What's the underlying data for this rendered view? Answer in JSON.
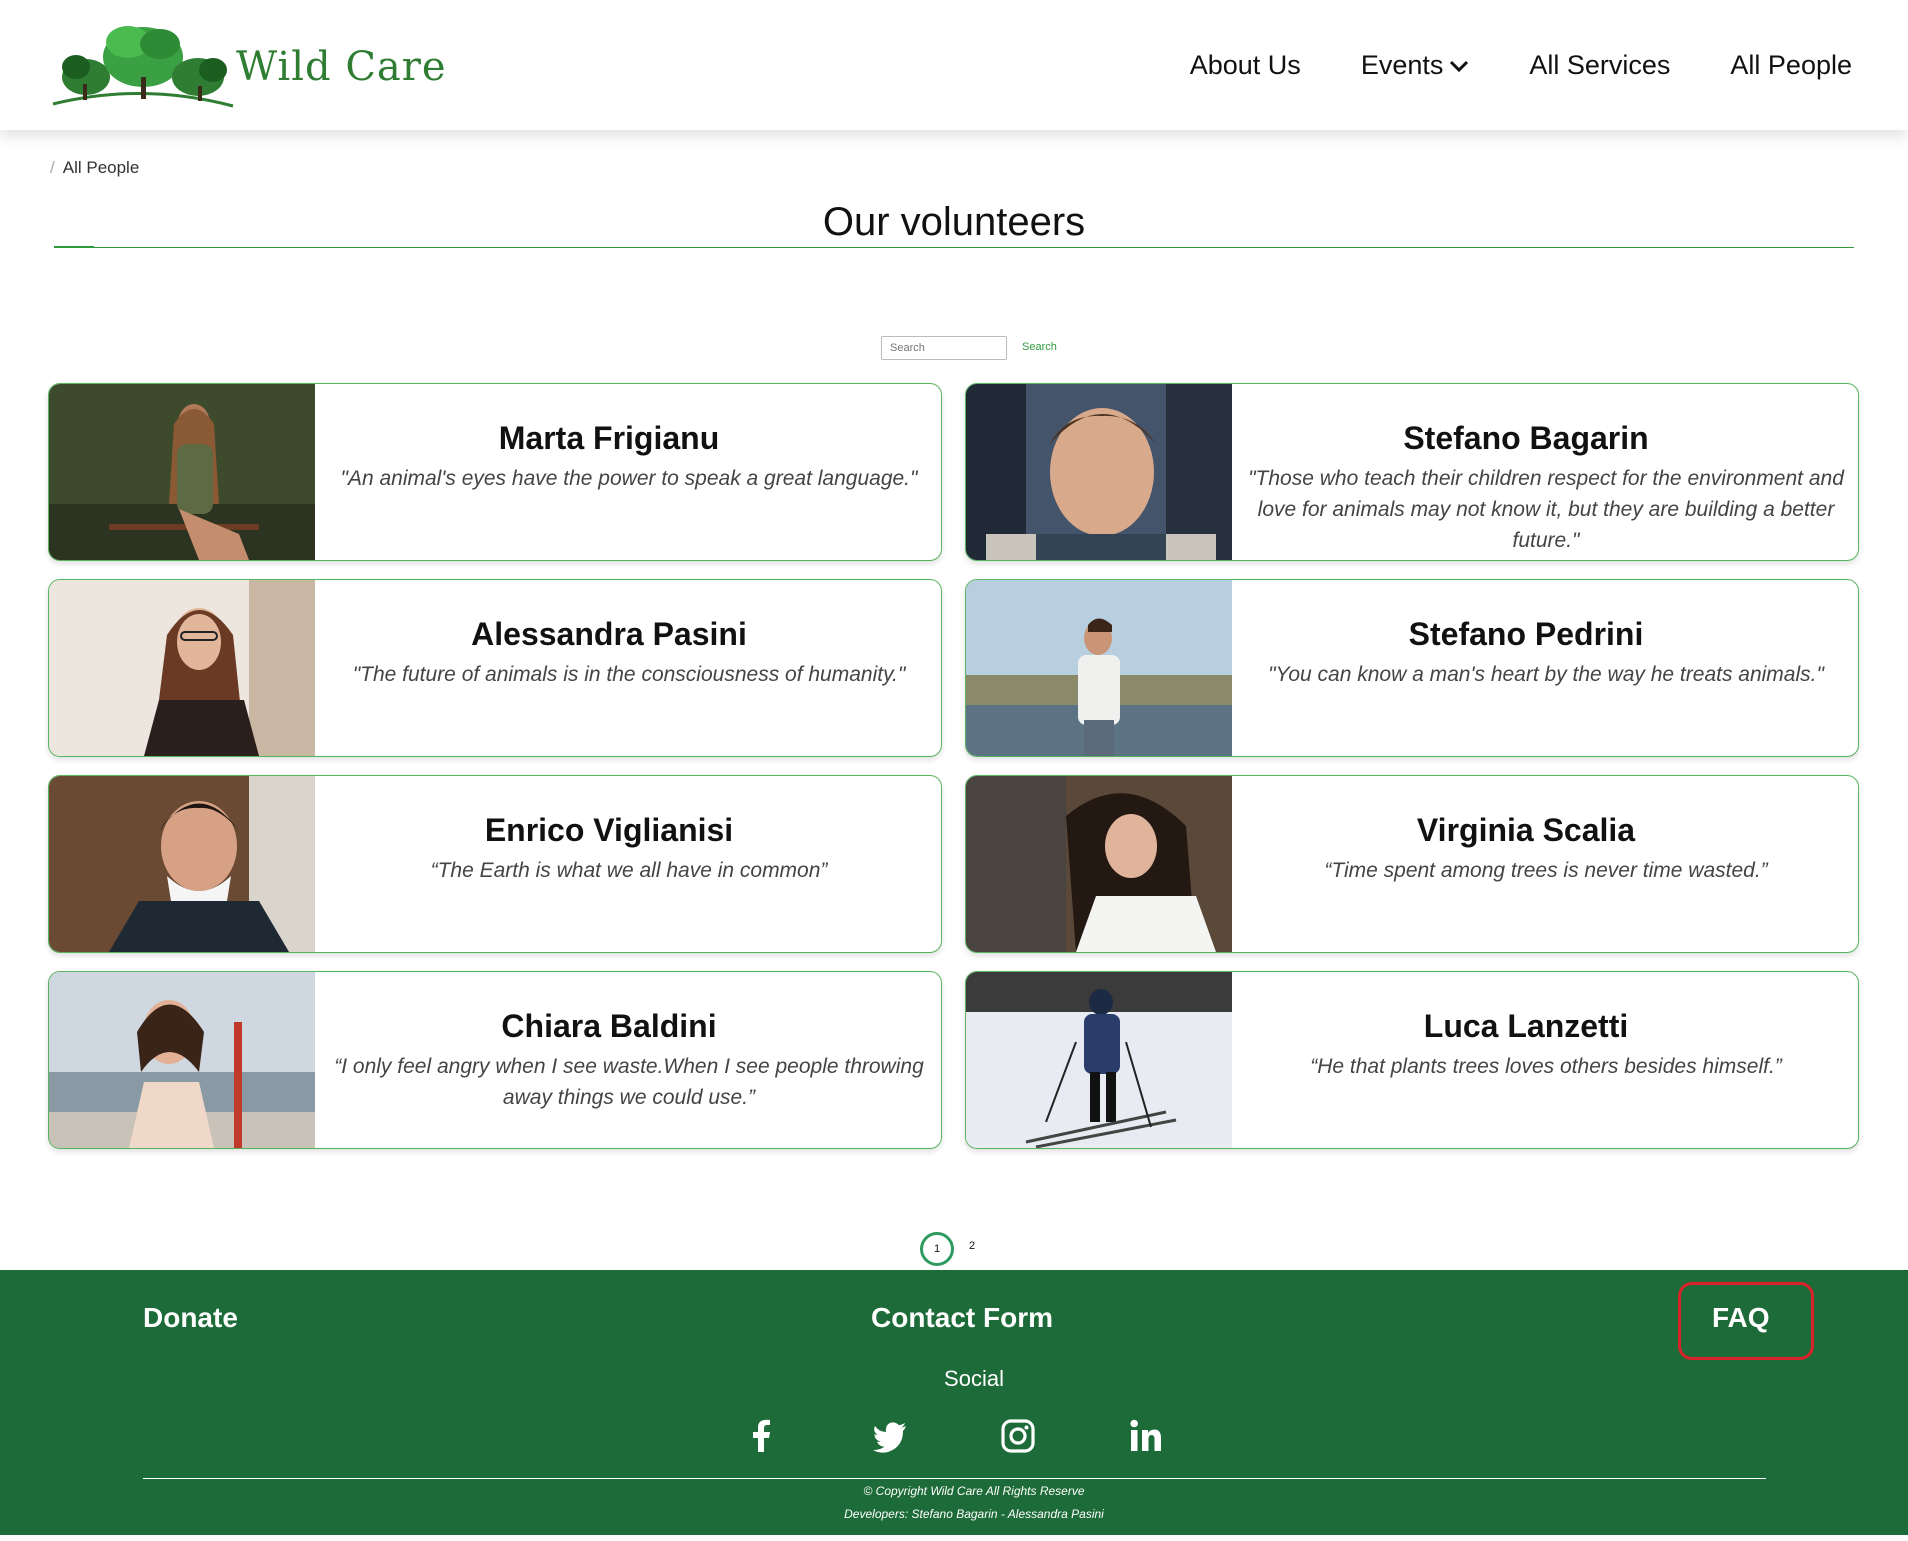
{
  "header": {
    "brand": "Wild Care",
    "nav": {
      "about": "About Us",
      "events": "Events",
      "services": "All Services",
      "people": "All People"
    }
  },
  "breadcrumb": {
    "current": "All People"
  },
  "page_title": "Our volunteers",
  "search": {
    "placeholder": "Search",
    "button": "Search"
  },
  "volunteers": [
    {
      "name": "Marta Frigianu",
      "quote": "\"An animal's eyes have the power to speak a great language.\""
    },
    {
      "name": "Stefano Bagarin",
      "quote": "\"Those who teach their children respect for the environment and love for animals may not know it, but they are building a better future.\""
    },
    {
      "name": "Alessandra Pasini",
      "quote": "\"The future of animals is in the consciousness of humanity.\""
    },
    {
      "name": "Stefano Pedrini",
      "quote": "\"You can know a man's heart by the way he treats animals.\""
    },
    {
      "name": "Enrico Viglianisi",
      "quote": "“The Earth is what we all have in common”"
    },
    {
      "name": "Virginia Scalia",
      "quote": "“Time spent among trees is never time wasted.”"
    },
    {
      "name": "Chiara Baldini",
      "quote": "“I only feel angry when I see waste.When I see people throwing away things we could use.”"
    },
    {
      "name": "Luca Lanzetti",
      "quote": "“He that plants trees loves others besides himself.”"
    }
  ],
  "pagination": {
    "current": "1",
    "next": "2"
  },
  "footer": {
    "donate": "Donate",
    "contact": "Contact Form",
    "faq": "FAQ",
    "social_label": "Social",
    "social_icons": [
      "facebook-icon",
      "twitter-icon",
      "instagram-icon",
      "linkedin-icon"
    ],
    "copyright": "© Copyright Wild Care All Rights Reserve",
    "developers": "Developers: Stefano Bagarin - Alessandra Pasini"
  },
  "colors": {
    "brand_green": "#2e7d32",
    "footer_green": "#1d6b38",
    "card_border": "#58b45f",
    "highlight_red": "#d8232a"
  }
}
